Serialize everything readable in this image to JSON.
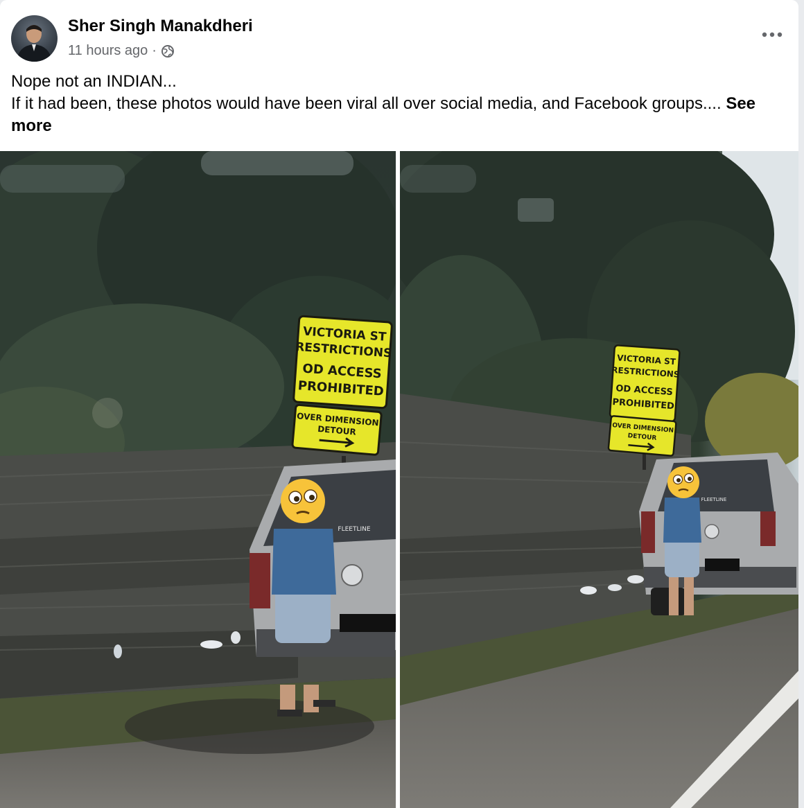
{
  "post": {
    "author": "Sher Singh Manakdheri",
    "timestamp": "11 hours ago",
    "separator": "·",
    "privacy_icon": "globe-icon",
    "more_icon": "more-options-icon",
    "text_line1": "Nope not an INDIAN...",
    "text_line2": "If it had been, these photos would have been viral all over social media, and Facebook groups....",
    "see_more": "See more"
  },
  "photos": [
    {
      "sign_top": [
        "VICTORIA ST",
        "RESTRICTIONS",
        "OD ACCESS",
        "PROHIBITED"
      ],
      "sign_bottom": [
        "OVER DIMENSION",
        "DETOUR"
      ],
      "vehicle_text": "FLEETLINE"
    },
    {
      "sign_top": [
        "VICTORIA ST",
        "RESTRICTIONS",
        "OD ACCESS",
        "PROHIBITED"
      ],
      "sign_bottom": [
        "OVER DIMENSION",
        "DETOUR"
      ],
      "vehicle_text": "FLEETLINE"
    }
  ],
  "colors": {
    "sign_yellow": "#e6e62a",
    "text_primary": "#050505",
    "text_secondary": "#65676b"
  }
}
